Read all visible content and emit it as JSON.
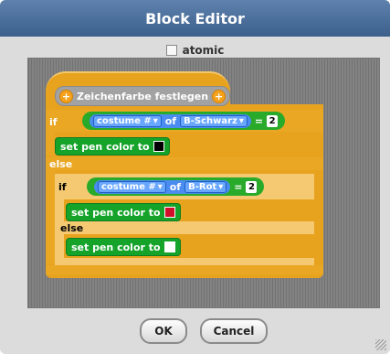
{
  "window": {
    "title": "Block Editor"
  },
  "atomic": {
    "label": "atomic",
    "checked": false
  },
  "definition": {
    "label": "Zeichenfarbe festlegen"
  },
  "blocks": {
    "if_outer": {
      "keyword": "if",
      "reporter": "costume #",
      "of": "of",
      "sprite": "B-Schwarz",
      "operator": "=",
      "value": "2",
      "then_cmd": "set pen color to",
      "then_color": "#000000",
      "else": "else"
    },
    "if_inner": {
      "keyword": "if",
      "reporter": "costume #",
      "of": "of",
      "sprite": "B-Rot",
      "operator": "=",
      "value": "2",
      "then_cmd": "set pen color to",
      "then_color": "#d0102a",
      "else": "else",
      "else_cmd": "set pen color to",
      "else_color": "#ffffff"
    }
  },
  "buttons": {
    "ok": "OK",
    "cancel": "Cancel"
  }
}
